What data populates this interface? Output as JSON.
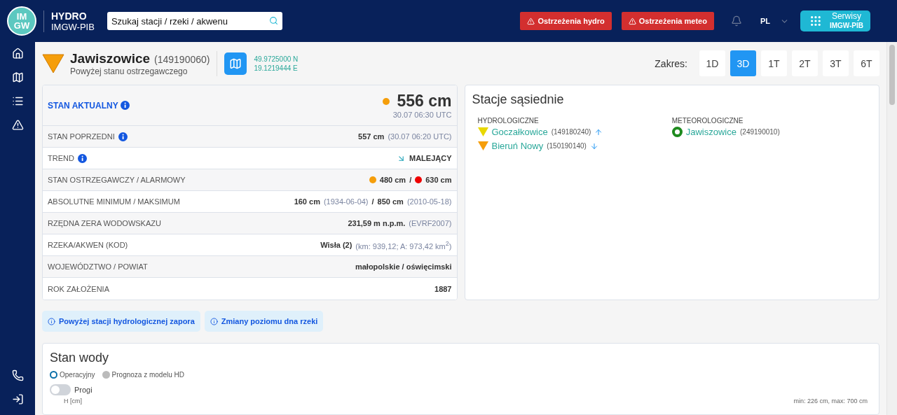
{
  "header": {
    "logo": {
      "top": "IM",
      "bottom": "GW"
    },
    "brand": {
      "title": "HYDRO",
      "subtitle": "IMGW-PIB"
    },
    "search": {
      "placeholder": "Szukaj stacji / rzeki / akwenu"
    },
    "alerts": [
      "Ostrzeżenia hydro",
      "Ostrzeżenia meteo"
    ],
    "language": "PL",
    "services": {
      "title": "Serwisy",
      "subtitle": "IMGW-PIB"
    }
  },
  "station": {
    "name": "Jawiszowice",
    "code": "(149190060)",
    "status": "Powyżej stanu ostrzegawczego",
    "color": "#f59e0b",
    "lat": "49.9725000 N",
    "lon": "19.1219444 E"
  },
  "range": {
    "label": "Zakres:",
    "options": [
      {
        "label": "1D",
        "selected": false
      },
      {
        "label": "3D",
        "selected": true
      },
      {
        "label": "1T",
        "selected": false
      },
      {
        "label": "2T",
        "selected": false
      },
      {
        "label": "3T",
        "selected": false
      },
      {
        "label": "6T",
        "selected": false
      }
    ]
  },
  "current": {
    "label": "STAN AKTUALNY",
    "value": "556 cm",
    "time": "30.07 06:30 UTC",
    "color": "#f59e0b"
  },
  "rows": [
    {
      "label": "STAN POPRZEDNI",
      "info": true,
      "parts": [
        {
          "kind": "value",
          "text": "557 cm"
        },
        {
          "kind": "note",
          "text": "(30.07 06:20 UTC)"
        }
      ]
    },
    {
      "label": "TREND",
      "info": true,
      "parts": [
        {
          "kind": "trend-down"
        },
        {
          "kind": "value",
          "text": "MALEJĄCY"
        }
      ]
    },
    {
      "label": "STAN OSTRZEGAWCZY / ALARMOWY",
      "info": false,
      "parts": [
        {
          "kind": "dot",
          "color": "#f59e0b"
        },
        {
          "kind": "value",
          "text": "480 cm"
        },
        {
          "kind": "sep",
          "text": "/"
        },
        {
          "kind": "dot",
          "color": "#ee0000"
        },
        {
          "kind": "value",
          "text": "630 cm"
        }
      ]
    },
    {
      "label": "ABSOLUTNE MINIMUM / MAKSIMUM",
      "info": false,
      "parts": [
        {
          "kind": "value",
          "text": "160 cm"
        },
        {
          "kind": "note",
          "text": "(1934-06-04)"
        },
        {
          "kind": "sep",
          "text": "/"
        },
        {
          "kind": "value",
          "text": "850 cm"
        },
        {
          "kind": "note",
          "text": "(2010-05-18)"
        }
      ]
    },
    {
      "label": "RZĘDNA ZERA WODOWSKAZU",
      "info": false,
      "parts": [
        {
          "kind": "value",
          "text": "231,59 m n.p.m."
        },
        {
          "kind": "note",
          "text": "(EVRF2007)"
        }
      ]
    },
    {
      "label": "RZEKA/AKWEN (KOD)",
      "info": false,
      "parts": [
        {
          "kind": "value",
          "text": "Wisła (2)"
        },
        {
          "kind": "note",
          "text": "(km: 939,12; A: 973,42 km$^{2}$)"
        }
      ]
    },
    {
      "label": "WOJEWÓDZTWO / POWIAT",
      "info": false,
      "parts": [
        {
          "kind": "value",
          "text": "małopolskie / oświęcimski"
        }
      ]
    },
    {
      "label": "ROK ZAŁOŻENIA",
      "info": false,
      "parts": [
        {
          "kind": "value",
          "text": "1887"
        }
      ]
    }
  ],
  "neighbors": {
    "title": "Stacje sąsiednie",
    "groups": [
      {
        "title": "HYDROLOGICZNE",
        "stations": [
          {
            "kind": "hydro",
            "color": "#e8d800",
            "name": "Goczałkowice",
            "code": "(149180240)",
            "rising": true
          },
          {
            "kind": "hydro",
            "color": "#f59e0b",
            "name": "Bieruń Nowy",
            "code": "(150190140)",
            "rising": false
          }
        ]
      },
      {
        "title": "METEOROLOGICZNE",
        "stations": [
          {
            "kind": "meteo",
            "color": "#1e8a1e",
            "name": "Jawiszowice",
            "code": "(249190010)"
          }
        ]
      }
    ]
  },
  "notes": [
    "Powyżej stacji hydrologicznej zapora",
    "Zmiany poziomu dna rzeki"
  ],
  "water": {
    "title": "Stan wody",
    "sources": [
      {
        "label": "Operacyjny",
        "selected": true
      },
      {
        "label": "Prognoza z modelu HD",
        "selected": false
      }
    ],
    "thresholds": {
      "label": "Progi",
      "on": false
    },
    "axis_label": "H [cm]",
    "range_text": "min: 226 cm, max: 700 cm"
  }
}
